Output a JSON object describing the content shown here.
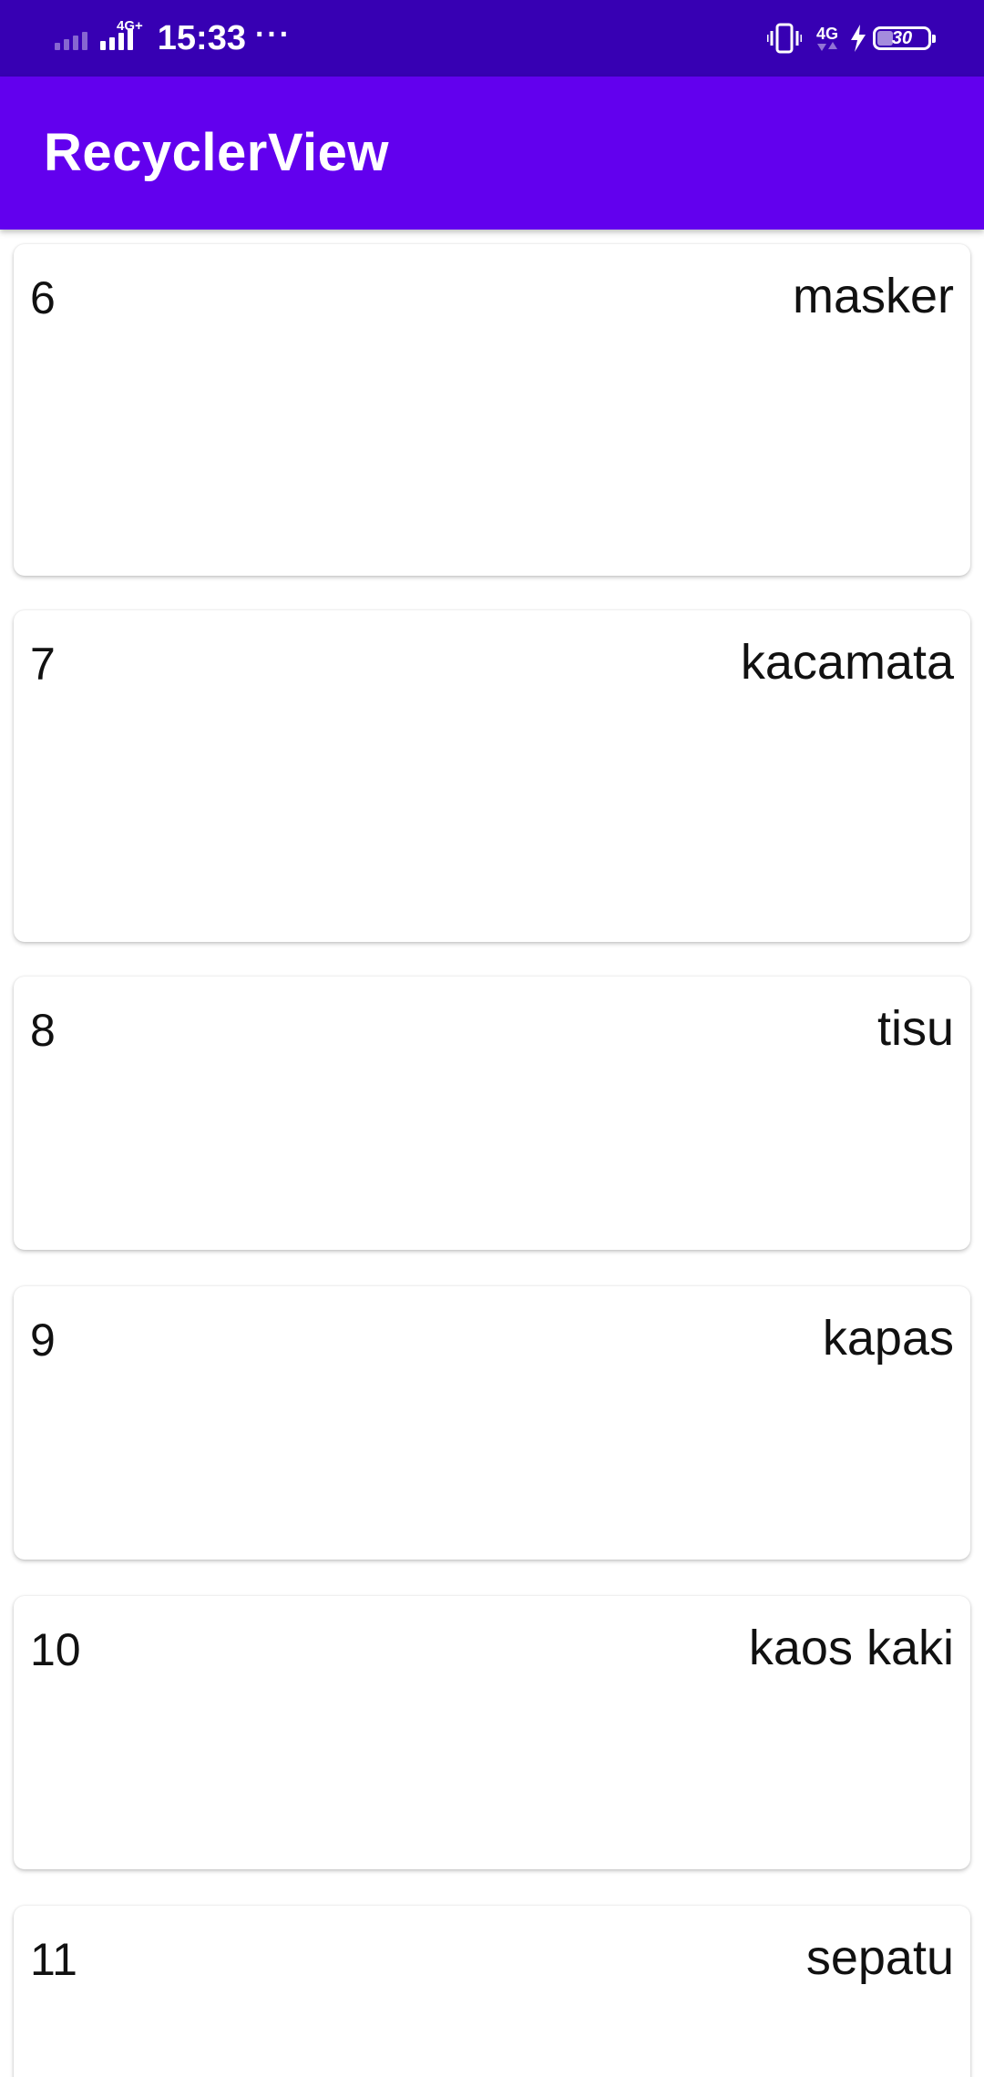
{
  "status_bar": {
    "time": "15:33",
    "network_left": "4G+",
    "network_right": "4G",
    "battery": "30",
    "more": "···"
  },
  "app_bar": {
    "title": "RecyclerView"
  },
  "colors": {
    "status_bar": "#3700b3",
    "app_bar": "#6200ee",
    "card_background": "#ffffff"
  },
  "items": [
    {
      "number": "6",
      "name": "masker"
    },
    {
      "number": "7",
      "name": "kacamata"
    },
    {
      "number": "8",
      "name": "tisu"
    },
    {
      "number": "9",
      "name": "kapas"
    },
    {
      "number": "10",
      "name": "kaos kaki"
    },
    {
      "number": "11",
      "name": "sepatu"
    }
  ]
}
